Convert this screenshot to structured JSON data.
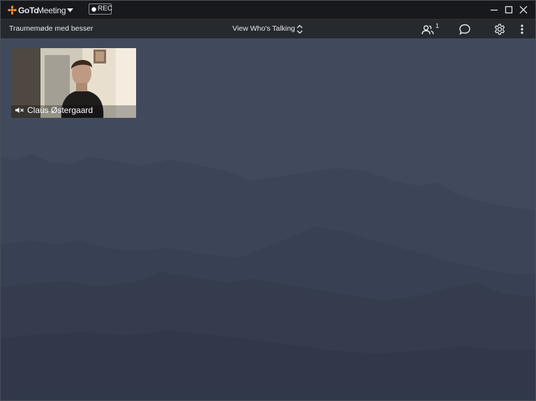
{
  "titlebar": {
    "brand_bold": "GoTo",
    "brand_regular": "Meeting",
    "rec_label": "REC"
  },
  "toolbar": {
    "meeting_name": "Traumemøde med besser",
    "view_mode": "View Who's Talking",
    "attendee_count": "1"
  },
  "video": {
    "participant_name": "Claus Østergaard"
  },
  "colors": {
    "brand_orange": "#f68d2e",
    "titlebar_bg": "#17191c",
    "toolbar_bg": "#26292e",
    "stage_bg": "#3b4352"
  }
}
